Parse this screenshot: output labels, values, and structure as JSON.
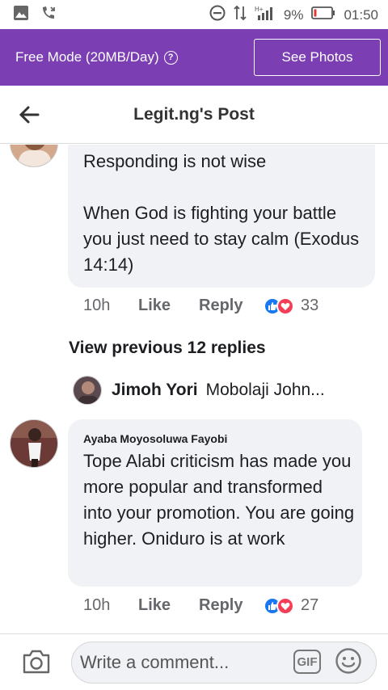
{
  "status_bar": {
    "time": "01:50",
    "battery": "9%",
    "network": "H+"
  },
  "promo": {
    "text": "Free Mode (20MB/Day)",
    "info_icon": "info-icon",
    "button_label": "See Photos"
  },
  "header": {
    "title": "Legit.ng's Post",
    "back_icon": "back-arrow-icon"
  },
  "comments": [
    {
      "text": "Responding is not wise\n\nWhen God is fighting your battle you just need to stay calm (Exodus 14:14)",
      "time": "10h",
      "like_label": "Like",
      "reply_label": "Reply",
      "reaction_count": "33"
    },
    {
      "author": "Ayaba Moyosoluwa Fayobi",
      "text": "Tope Alabi criticism has made you more popular and transformed into your promotion. You are going higher. Oniduro is at work",
      "time": "10h",
      "like_label": "Like",
      "reply_label": "Reply",
      "reaction_count": "27"
    }
  ],
  "view_previous": "View previous 12 replies",
  "reply_preview": {
    "author": "Jimoh Yori",
    "text": "Mobolaji John..."
  },
  "composer": {
    "placeholder": "Write a comment...",
    "gif_label": "GIF"
  },
  "colors": {
    "promo_bg": "#7b3fb3",
    "bubble_bg": "#f0f2f5",
    "like_blue": "#1877f2",
    "love_red": "#f33e58"
  }
}
